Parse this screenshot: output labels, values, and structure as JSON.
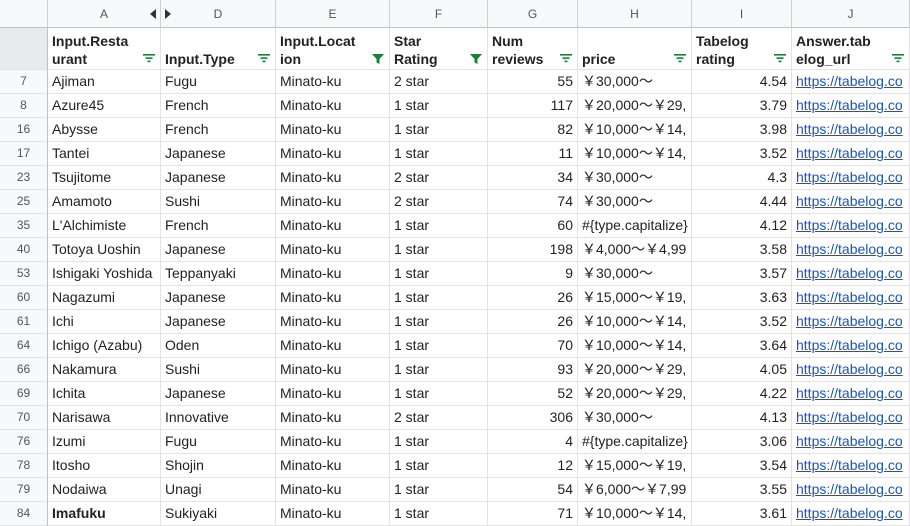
{
  "columns": [
    "A",
    "D",
    "E",
    "F",
    "G",
    "H",
    "I",
    "J"
  ],
  "headers": [
    {
      "text": "Input.Restaurant",
      "lines": [
        "Input.Resta",
        "urant"
      ],
      "filter": "filter-icon"
    },
    {
      "text": "Input.Type",
      "lines": [
        "",
        "Input.Type"
      ],
      "filter": "filter-icon"
    },
    {
      "text": "Input.Location",
      "lines": [
        "Input.Locat",
        "ion"
      ],
      "filter": "filter-active-icon"
    },
    {
      "text": "Star Rating",
      "lines": [
        "Star",
        "Rating"
      ],
      "filter": "filter-active-icon"
    },
    {
      "text": "Num reviews",
      "lines": [
        "Num",
        "reviews"
      ],
      "filter": "filter-icon"
    },
    {
      "text": "price",
      "lines": [
        "",
        "price"
      ],
      "filter": "filter-icon"
    },
    {
      "text": "Tabelog rating",
      "lines": [
        "Tabelog",
        "rating"
      ],
      "filter": "filter-icon"
    },
    {
      "text": "Answer.tabelog_url",
      "lines": [
        "Answer.tab",
        "elog_url"
      ],
      "filter": "filter-icon"
    }
  ],
  "header_row_number": "1",
  "rows": [
    {
      "n": "7",
      "cells": [
        "Ajiman",
        "Fugu",
        "Minato-ku",
        "2 star",
        "55",
        "￥30,000～",
        "4.54",
        "https://tabelog.co"
      ]
    },
    {
      "n": "8",
      "cells": [
        "Azure45",
        "French",
        "Minato-ku",
        "1 star",
        "117",
        "￥20,000～￥29,",
        "3.79",
        "https://tabelog.co"
      ]
    },
    {
      "n": "16",
      "cells": [
        "Abysse",
        "French",
        "Minato-ku",
        "1 star",
        "82",
        "￥10,000～￥14,",
        "3.98",
        "https://tabelog.co"
      ]
    },
    {
      "n": "17",
      "cells": [
        "Tantei",
        "Japanese",
        "Minato-ku",
        "1 star",
        "11",
        "￥10,000～￥14,",
        "3.52",
        "https://tabelog.co"
      ]
    },
    {
      "n": "23",
      "cells": [
        "Tsujitome",
        "Japanese",
        "Minato-ku",
        "2 star",
        "34",
        "￥30,000～",
        "4.3",
        "https://tabelog.co"
      ]
    },
    {
      "n": "25",
      "cells": [
        "Amamoto",
        "Sushi",
        "Minato-ku",
        "2 star",
        "74",
        "￥30,000～",
        "4.44",
        "https://tabelog.co"
      ]
    },
    {
      "n": "35",
      "cells": [
        "L'Alchimiste",
        "French",
        "Minato-ku",
        "1 star",
        "60",
        "#{type.capitalize}",
        "4.12",
        "https://tabelog.co"
      ]
    },
    {
      "n": "40",
      "cells": [
        "Totoya Uoshin",
        "Japanese",
        "Minato-ku",
        "1 star",
        "198",
        "￥4,000～￥4,99",
        "3.58",
        "https://tabelog.co"
      ]
    },
    {
      "n": "53",
      "cells": [
        "Ishigaki Yoshida",
        "Teppanyaki",
        "Minato-ku",
        "1 star",
        "9",
        "￥30,000～",
        "3.57",
        "https://tabelog.co"
      ]
    },
    {
      "n": "60",
      "cells": [
        "Nagazumi",
        "Japanese",
        "Minato-ku",
        "1 star",
        "26",
        "￥15,000～￥19,",
        "3.63",
        "https://tabelog.co"
      ]
    },
    {
      "n": "61",
      "cells": [
        "Ichi",
        "Japanese",
        "Minato-ku",
        "1 star",
        "26",
        "￥10,000～￥14,",
        "3.52",
        "https://tabelog.co"
      ]
    },
    {
      "n": "64",
      "cells": [
        "Ichigo (Azabu)",
        "Oden",
        "Minato-ku",
        "1 star",
        "70",
        "￥10,000～￥14,",
        "3.64",
        "https://tabelog.co"
      ]
    },
    {
      "n": "66",
      "cells": [
        "Nakamura",
        "Sushi",
        "Minato-ku",
        "1 star",
        "93",
        "￥20,000～￥29,",
        "4.05",
        "https://tabelog.co"
      ]
    },
    {
      "n": "69",
      "cells": [
        "Ichita",
        "Japanese",
        "Minato-ku",
        "1 star",
        "52",
        "￥20,000～￥29,",
        "4.22",
        "https://tabelog.co"
      ]
    },
    {
      "n": "70",
      "cells": [
        "Narisawa",
        "Innovative",
        "Minato-ku",
        "2 star",
        "306",
        "￥30,000～",
        "4.13",
        "https://tabelog.co"
      ]
    },
    {
      "n": "76",
      "cells": [
        "Izumi",
        "Fugu",
        "Minato-ku",
        "1 star",
        "4",
        "#{type.capitalize}",
        "3.06",
        "https://tabelog.co"
      ]
    },
    {
      "n": "78",
      "cells": [
        "Itosho",
        "Shojin",
        "Minato-ku",
        "1 star",
        "12",
        "￥15,000～￥19,",
        "3.54",
        "https://tabelog.co"
      ]
    },
    {
      "n": "79",
      "cells": [
        "Nodaiwa",
        "Unagi",
        "Minato-ku",
        "1 star",
        "54",
        "￥6,000～￥7,99",
        "3.55",
        "https://tabelog.co"
      ]
    },
    {
      "n": "84",
      "cells": [
        "Imafuku",
        "Sukiyaki",
        "Minato-ku",
        "1 star",
        "71",
        "￥10,000～￥14,",
        "3.61",
        "https://tabelog.co"
      ],
      "bold_first": true
    }
  ],
  "colors": {
    "link": "#1155cc",
    "filter_active": "#188038",
    "filter": "#188038",
    "header_bg": "#f8f9fa"
  }
}
